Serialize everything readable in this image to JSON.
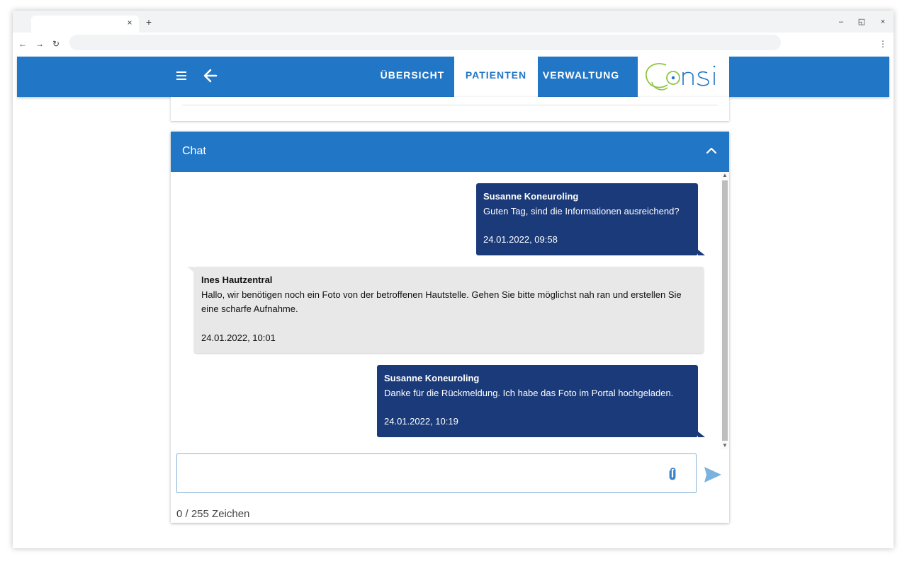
{
  "browser": {
    "tab_close": "×",
    "new_tab": "+",
    "minimize": "–",
    "restore": "◱",
    "close": "×",
    "nav_back": "←",
    "nav_forward": "→",
    "reload": "↻",
    "menu": "⋮"
  },
  "header": {
    "nav_tabs": [
      {
        "label": "ÜBERSICHT",
        "active": false
      },
      {
        "label": "PATIENTEN",
        "active": true
      },
      {
        "label": "VERWALTUNG",
        "active": false
      }
    ],
    "logo_text": "Consi",
    "accent_color": "#2176c6"
  },
  "chat": {
    "title": "Chat",
    "messages": [
      {
        "sender": "Susanne Koneuroling",
        "text": "Guten Tag, sind die Informationen ausreichend?",
        "time": "24.01.2022, 09:58",
        "direction": "out"
      },
      {
        "sender": "Ines Hautzentral",
        "text": "Hallo, wir benötigen noch ein Foto von der betroffenen Hautstelle. Gehen Sie bitte möglichst nah ran und erstellen Sie eine scharfe Aufnahme.",
        "time": "24.01.2022, 10:01",
        "direction": "in"
      },
      {
        "sender": "Susanne Koneuroling",
        "text": "Danke für die Rückmeldung. Ich habe das Foto im Portal hochgeladen.",
        "time": "24.01.2022, 10:19",
        "direction": "out"
      }
    ],
    "input_value": "",
    "char_count": "0 / 255 Zeichen",
    "outgoing_color": "#1a3a7a",
    "incoming_color": "#e8e8e8"
  },
  "icons": {
    "menu": "menu-icon",
    "back": "arrow-left-icon",
    "collapse": "chevron-up-icon",
    "attach": "paperclip-icon",
    "send": "send-icon"
  }
}
